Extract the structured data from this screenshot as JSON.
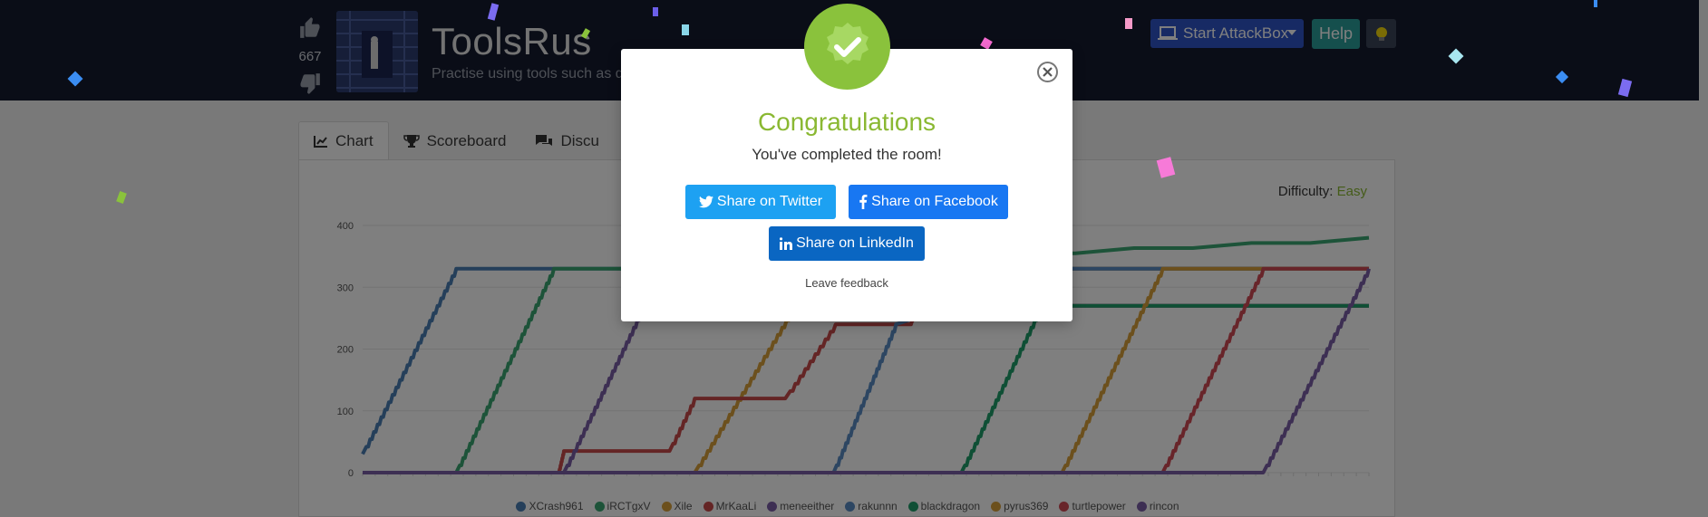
{
  "header": {
    "vote_count": "667",
    "room_title": "ToolsRus",
    "room_subtitle": "Practise using tools such as d",
    "attackbox_label": "Start AttackBox",
    "help_label": "Help"
  },
  "tabs": [
    {
      "label": "Chart",
      "icon": "chart-line-icon"
    },
    {
      "label": "Scoreboard",
      "icon": "trophy-icon"
    },
    {
      "label": "Discu",
      "icon": "comments-icon"
    }
  ],
  "difficulty": {
    "label": "Difficulty:",
    "value": "Easy"
  },
  "chart_data": {
    "type": "line",
    "title": "",
    "xlabel": "",
    "ylabel": "",
    "ylim": [
      0,
      400
    ],
    "yticks": [
      0,
      100,
      200,
      300,
      400
    ],
    "grid": true,
    "legend_position": "bottom",
    "series": [
      {
        "name": "XCrash961",
        "color": "#4a7fb5",
        "points": [
          [
            0,
            30
          ],
          [
            0.093,
            330
          ],
          [
            0.25,
            330
          ],
          [
            1.0,
            330
          ]
        ]
      },
      {
        "name": "iRCTgxV",
        "color": "#3aa672",
        "points": [
          [
            0,
            0
          ],
          [
            0.093,
            0
          ],
          [
            0.19,
            330
          ],
          [
            0.3,
            330
          ],
          [
            1.0,
            380
          ]
        ]
      },
      {
        "name": "Xile",
        "color": "#d9a03a",
        "points": [
          [
            0,
            0
          ],
          [
            0.33,
            0
          ],
          [
            0.43,
            270
          ],
          [
            0.5,
            330
          ],
          [
            1.0,
            330
          ]
        ]
      },
      {
        "name": "MrKaaLi",
        "color": "#c94a4a",
        "points": [
          [
            0,
            0
          ],
          [
            0.195,
            0
          ],
          [
            0.2,
            35
          ],
          [
            0.305,
            35
          ],
          [
            0.33,
            120
          ],
          [
            0.42,
            120
          ],
          [
            0.47,
            240
          ],
          [
            0.545,
            240
          ],
          [
            0.55,
            270
          ],
          [
            1.0,
            270
          ]
        ]
      },
      {
        "name": "meneeither",
        "color": "#7b5ea7",
        "points": [
          [
            0,
            0
          ],
          [
            0.2,
            0
          ],
          [
            0.28,
            270
          ],
          [
            1.0,
            270
          ]
        ]
      },
      {
        "name": "rakunnn",
        "color": "#5a8cc4",
        "points": [
          [
            0,
            0
          ],
          [
            0.468,
            0
          ],
          [
            0.53,
            240
          ],
          [
            0.7,
            330
          ],
          [
            1.0,
            330
          ]
        ]
      },
      {
        "name": "blackdragon",
        "color": "#1f9e6a",
        "points": [
          [
            0,
            0
          ],
          [
            0.595,
            0
          ],
          [
            0.675,
            270
          ],
          [
            1.0,
            270
          ]
        ]
      },
      {
        "name": "pyrus369",
        "color": "#d9a03a",
        "points": [
          [
            0,
            0
          ],
          [
            0.695,
            0
          ],
          [
            0.795,
            330
          ],
          [
            1.0,
            330
          ]
        ]
      },
      {
        "name": "turtlepower",
        "color": "#d04a55",
        "points": [
          [
            0,
            0
          ],
          [
            0.795,
            0
          ],
          [
            0.895,
            330
          ],
          [
            1.0,
            330
          ]
        ]
      },
      {
        "name": "rincon",
        "color": "#7b5ea7",
        "points": [
          [
            0,
            0
          ],
          [
            0.895,
            0
          ],
          [
            1.0,
            330
          ]
        ]
      }
    ]
  },
  "modal": {
    "title": "Congratulations",
    "subtitle": "You've completed the room!",
    "twitter": "Share on Twitter",
    "facebook": "Share on Facebook",
    "linkedin": "Share on LinkedIn",
    "feedback": "Leave feedback"
  }
}
